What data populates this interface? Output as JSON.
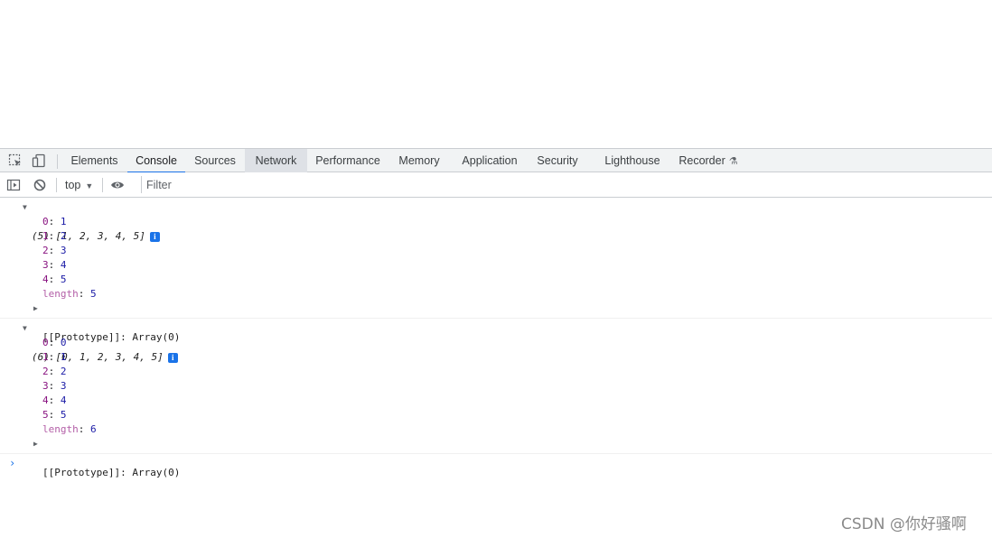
{
  "devtools": {
    "tabs": [
      {
        "label": "Elements"
      },
      {
        "label": "Console"
      },
      {
        "label": "Sources"
      },
      {
        "label": "Network"
      },
      {
        "label": "Performance"
      },
      {
        "label": "Memory"
      },
      {
        "label": "Application"
      },
      {
        "label": "Security"
      },
      {
        "label": "Lighthouse"
      },
      {
        "label": "Recorder"
      }
    ],
    "selected_tab": "Console",
    "hovered_tab": "Network"
  },
  "console_toolbar": {
    "context": "top",
    "filter_placeholder": "Filter"
  },
  "console": {
    "messages": [
      {
        "summary": "(5) [1, 2, 3, 4, 5]",
        "badge": "i",
        "entries": [
          {
            "key": "0",
            "value": "1"
          },
          {
            "key": "1",
            "value": "2"
          },
          {
            "key": "2",
            "value": "3"
          },
          {
            "key": "3",
            "value": "4"
          },
          {
            "key": "4",
            "value": "5"
          }
        ],
        "length_key": "length",
        "length_value": "5",
        "prototype": "[[Prototype]]: Array(0)"
      },
      {
        "summary": "(6) [0, 1, 2, 3, 4, 5]",
        "badge": "i",
        "entries": [
          {
            "key": "0",
            "value": "0"
          },
          {
            "key": "1",
            "value": "1"
          },
          {
            "key": "2",
            "value": "2"
          },
          {
            "key": "3",
            "value": "3"
          },
          {
            "key": "4",
            "value": "4"
          },
          {
            "key": "5",
            "value": "5"
          }
        ],
        "length_key": "length",
        "length_value": "6",
        "prototype": "[[Prototype]]: Array(0)"
      }
    ],
    "prompt": "›"
  },
  "watermark": "CSDN @你好骚啊",
  "colors": {
    "accent": "#1a73e8",
    "tabbar_bg": "#f1f3f4",
    "key": "#881280",
    "number": "#1a1aa6"
  }
}
